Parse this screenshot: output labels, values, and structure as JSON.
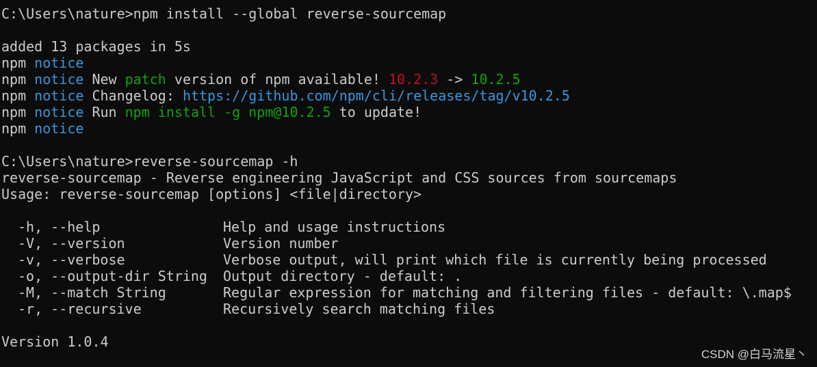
{
  "colors": {
    "background": "#0c0c0c",
    "text": "#cccccc",
    "notice_blue": "#3a96dd",
    "green": "#13a10e",
    "red": "#c50f1f"
  },
  "terminal": {
    "cmd1_prompt": "C:\\Users\\nature>",
    "cmd1_text": "npm install --global reverse-sourcemap",
    "added_line": "added 13 packages in 5s",
    "npm_label": "npm",
    "notice_label": "notice",
    "notice2_new": "New",
    "notice2_patch": "patch",
    "notice2_mid": "version of npm available!",
    "notice2_old_version": "10.2.3",
    "notice2_arrow": "->",
    "notice2_new_version": "10.2.5",
    "notice3_changelog": "Changelog:",
    "notice3_url": "https://github.com/npm/cli/releases/tag/v10.2.5",
    "notice4_run": "Run",
    "notice4_cmd": "npm install -g npm@10.2.5",
    "notice4_tail": "to update!",
    "cmd2_prompt": "C:\\Users\\nature>",
    "cmd2_text": "reverse-sourcemap -h",
    "desc_line": "reverse-sourcemap - Reverse engineering JavaScript and CSS sources from sourcemaps",
    "usage_line": "Usage: reverse-sourcemap [options] <file|directory>",
    "help_options": [
      {
        "opt": "-h, --help",
        "desc": "Help and usage instructions"
      },
      {
        "opt": "-V, --version",
        "desc": "Version number"
      },
      {
        "opt": "-v, --verbose",
        "desc": "Verbose output, will print which file is currently being processed"
      },
      {
        "opt": "-o, --output-dir String",
        "desc": "Output directory - default: ."
      },
      {
        "opt": "-M, --match String",
        "desc": "Regular expression for matching and filtering files - default: \\.map$"
      },
      {
        "opt": "-r, --recursive",
        "desc": "Recursively search matching files"
      }
    ],
    "version_line": "Version 1.0.4"
  },
  "watermark": "CSDN @白马流星丶"
}
